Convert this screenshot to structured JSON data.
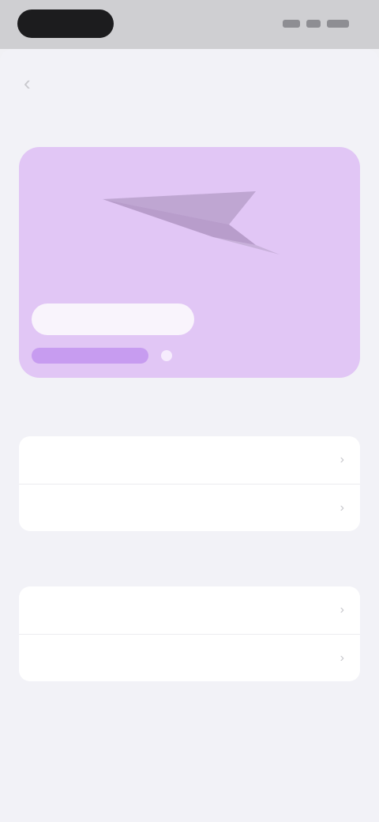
{
  "status_bar": {},
  "nav": {
    "back_glyph": "‹",
    "title": ""
  },
  "plan_section": {
    "label": "",
    "hero": {
      "primary_button": "",
      "secondary_button": "",
      "progress": 0.78,
      "art_icon": "paper-plane-icon",
      "background_color": "#e1c6f5",
      "accent_color": "#c79cf0"
    },
    "caption": ""
  },
  "usage_group": {
    "rows": [
      {
        "label": "",
        "value": ""
      },
      {
        "label": "",
        "value": ""
      }
    ]
  },
  "details_section": {
    "label": "",
    "rows": [
      {
        "label": "",
        "value": ""
      },
      {
        "label": "",
        "value": ""
      }
    ]
  },
  "footer": {
    "note": "",
    "link_text": ""
  },
  "colors": {
    "page_background": "#f2f2f7",
    "accent": "#c48be8"
  }
}
